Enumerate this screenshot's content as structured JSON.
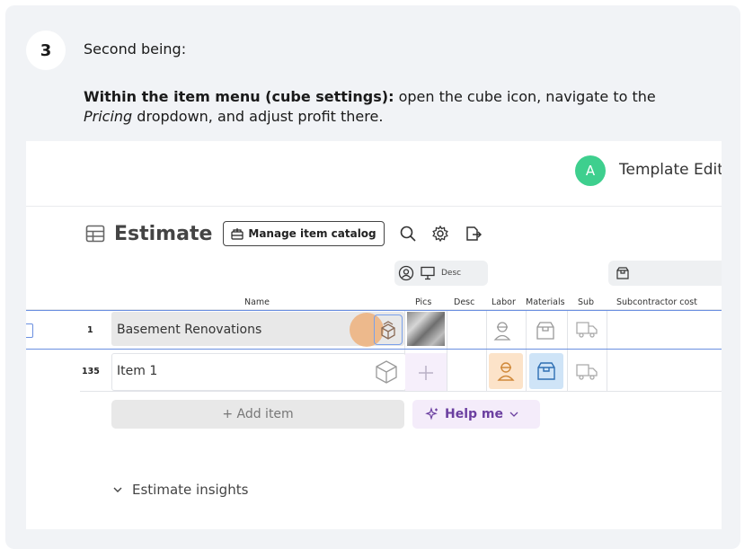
{
  "step": {
    "number": "3",
    "title": "Second being:",
    "instruction_bold": "Within the item menu (cube settings):",
    "instruction_part1": " open the cube icon, navigate to the ",
    "instruction_italic": "Pricing",
    "instruction_part2": " dropdown, and adjust profit there."
  },
  "app": {
    "avatar_letter": "A",
    "topbar_title": "Template Edit",
    "estimate_title": "Estimate",
    "manage_catalog_label": "Manage item catalog",
    "group_chip_label": "Desc",
    "columns": {
      "name": "Name",
      "pics": "Pics",
      "desc": "Desc",
      "labor": "Labor",
      "materials": "Materials",
      "sub": "Sub",
      "subcontractor_cost": "Subcontractor cost"
    },
    "rows": [
      {
        "number": "1",
        "name": "Basement Renovations"
      },
      {
        "number": "135",
        "name": "Item 1"
      }
    ],
    "add_item_label": "+ Add item",
    "help_me_label": "Help me",
    "insights_label": "Estimate insights"
  },
  "colors": {
    "accent_green": "#3ecf8e",
    "selection_blue": "#6a8fe0",
    "labor_orange": "#fce3c9",
    "materials_blue": "#cfe4f7",
    "help_purple": "#6b3fa0"
  },
  "icons": [
    "grid-icon",
    "catalog-icon",
    "search-icon",
    "settings-icon",
    "export-icon",
    "people-icon",
    "presentation-icon",
    "materials-icon",
    "cube-icon",
    "worker-icon",
    "truck-icon",
    "sparkle-icon",
    "chevron-down-icon"
  ]
}
